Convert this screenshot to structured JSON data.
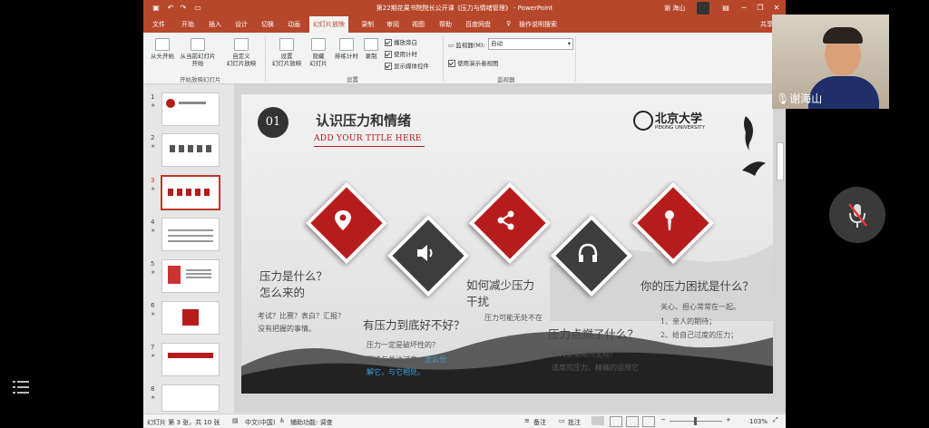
{
  "window": {
    "title": "第22期花果书院院长公开课《压力与情绪管理》 - PowerPoint",
    "user": "谢 海山",
    "share": "共享"
  },
  "tabs": [
    "文件",
    "开始",
    "插入",
    "设计",
    "切换",
    "动画",
    "幻灯片放映",
    "录制",
    "审阅",
    "视图",
    "帮助",
    "百度网盘"
  ],
  "tab_search": "操作说明搜索",
  "ribbon": {
    "btn_from_start": "从头开始",
    "btn_from_current_1": "从当前幻灯片",
    "btn_from_current_2": "开始",
    "btn_custom_1": "自定义",
    "btn_custom_2": "幻灯片放映",
    "group_start": "开始放映幻灯片",
    "btn_setup_1": "设置",
    "btn_setup_2": "幻灯片放映",
    "btn_hide_1": "隐藏",
    "btn_hide_2": "幻灯片",
    "btn_rehearse": "排练计时",
    "btn_record": "录制",
    "cb_narration": "播放旁白",
    "cb_timing": "使用计时",
    "cb_media": "显示媒体控件",
    "group_setup": "设置",
    "monitor_label": "监视器(M):",
    "monitor_value": "自动",
    "cb_presenter": "使用演示者视图",
    "group_monitor": "监视器"
  },
  "thumbs": [
    "1",
    "2",
    "3",
    "4",
    "5",
    "6",
    "7",
    "8"
  ],
  "slide": {
    "number": "01",
    "title": "认识压力和情绪",
    "subtitle": "ADD YOUR TITLE HERE",
    "logo_cn": "北京大学",
    "logo_en": "PEKING UNIVERSITY",
    "q1_1": "压力是什么？",
    "q1_2": "怎么来的",
    "q1_d1": "考试？比赛？表白？汇报？",
    "q1_d2": "没有把握的事情。",
    "q2": "有压力到底好不好？",
    "q2_d1": "压力一定是破坏性的？",
    "q2_d2a": "期待与关注过高，",
    "q2_d2b": "怎么分",
    "q2_d3": "解它，与它相处。",
    "q3_1": "如何减少压力",
    "q3_2": "干扰",
    "q3_d1": "压力可能无处不在",
    "q4": "压力点燃了什么？",
    "q4_d1": "如何变被动为主动？",
    "q4_d2": "适度的压力、精确的运用它",
    "q5": "你的压力困扰是什么？",
    "q5_d1": "关心、担心常常在一起。",
    "q5_d2": "1、亲人的期待；",
    "q5_d3": "2、给自己过度的压力；"
  },
  "status": {
    "slide_info": "幻灯片 第 3 张，共 10 张",
    "language": "中文(中国)",
    "accessibility": "辅助功能: 调查",
    "notes": "备注",
    "comments": "批注",
    "zoom": "103%"
  },
  "video": {
    "name": "谢海山"
  },
  "colors": {
    "accent": "#b7472a",
    "red": "#b71c1c",
    "dark": "#3d3d3d",
    "highlight": "#3aa0d8"
  }
}
